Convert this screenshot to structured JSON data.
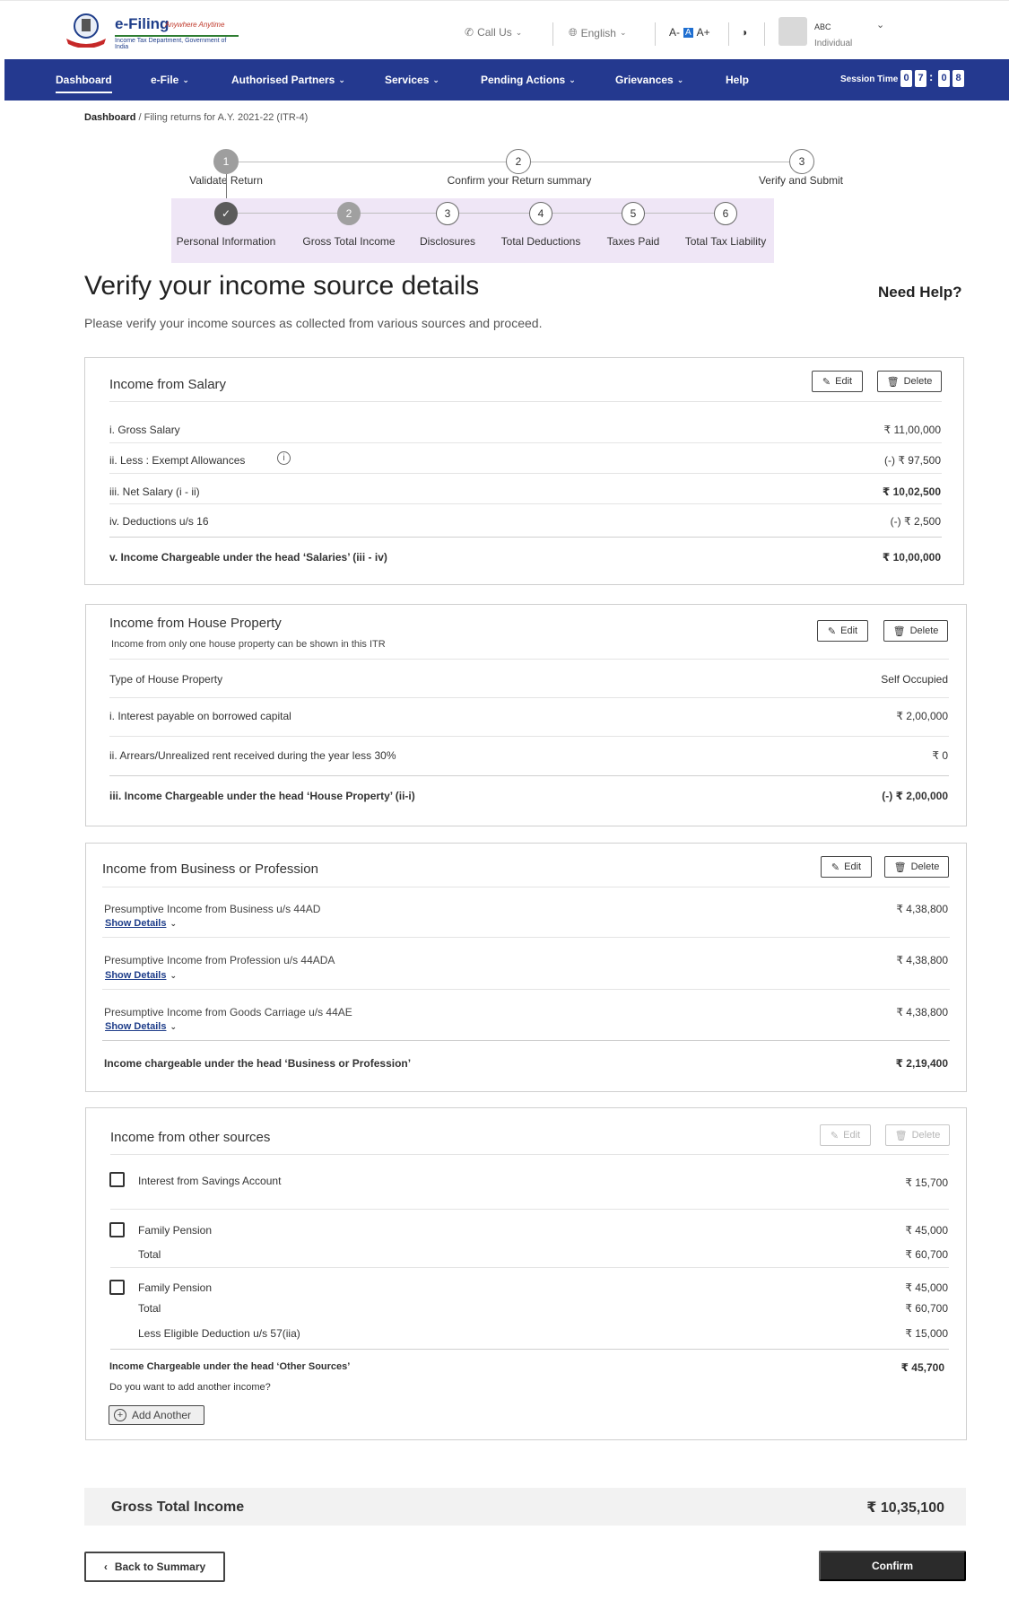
{
  "header": {
    "logo_title": "e-Filing",
    "logo_tagline": "Anywhere Anytime",
    "logo_subtitle": "Income Tax Department, Government of India",
    "call_us": "Call Us",
    "language": "English",
    "font_small": "A-",
    "font_normal": "A",
    "font_large": "A+",
    "user_name": "ABC",
    "user_type": "Individual"
  },
  "nav": {
    "items": [
      "Dashboard",
      "e-File",
      "Authorised Partners",
      "Services",
      "Pending Actions",
      "Grievances",
      "Help"
    ],
    "session_label": "Session Time",
    "session_digits": [
      "0",
      "7",
      "0",
      "8"
    ]
  },
  "breadcrumb": {
    "root": "Dashboard",
    "current": "/ Filing returns for A.Y. 2021-22 (ITR-4)"
  },
  "stepper": {
    "steps": [
      {
        "num": "1",
        "label": "Validate Return"
      },
      {
        "num": "2",
        "label": "Confirm your Return summary"
      },
      {
        "num": "3",
        "label": "Verify and Submit"
      }
    ],
    "substeps": [
      {
        "num": "✓",
        "label": "Personal Information"
      },
      {
        "num": "2",
        "label": "Gross Total Income"
      },
      {
        "num": "3",
        "label": "Disclosures"
      },
      {
        "num": "4",
        "label": "Total Deductions"
      },
      {
        "num": "5",
        "label": "Taxes Paid"
      },
      {
        "num": "6",
        "label": "Total Tax Liability"
      }
    ]
  },
  "page": {
    "title": "Verify your income source details",
    "need_help": "Need Help?",
    "description": "Please verify your income sources as collected from various sources and proceed."
  },
  "buttons": {
    "edit": "Edit",
    "delete": "Delete",
    "show_details": "Show Details",
    "add_another": "Add Another",
    "back": "Back to Summary",
    "confirm": "Confirm"
  },
  "salary": {
    "title": "Income from Salary",
    "rows": [
      {
        "label": "i. Gross Salary",
        "value": "₹ 11,00,000"
      },
      {
        "label": "ii. Less : Exempt Allowances",
        "value": "(-) ₹ 97,500"
      },
      {
        "label": "iii. Net Salary (i - ii)",
        "value": "₹ 10,02,500"
      },
      {
        "label": "iv. Deductions u/s 16",
        "value": "(-) ₹ 2,500"
      },
      {
        "label": "v. Income Chargeable under the head ‘Salaries’  (iii - iv)",
        "value": "₹ 10,00,000"
      }
    ]
  },
  "house": {
    "title": "Income from House Property",
    "note": "Income from only one house property can be shown in this ITR",
    "rows": [
      {
        "label": "Type of House Property",
        "value": "Self Occupied"
      },
      {
        "label": "i. Interest payable on borrowed capital",
        "value": "₹ 2,00,000"
      },
      {
        "label": "ii. Arrears/Unrealized rent received during the year less 30%",
        "value": "₹ 0"
      },
      {
        "label": "iii. Income Chargeable under the head ‘House Property’ (ii-i)",
        "value": "(-) ₹ 2,00,000"
      }
    ]
  },
  "business": {
    "title": "Income from Business or Profession",
    "rows": [
      {
        "label": "Presumptive Income from Business u/s 44AD",
        "value": "₹ 4,38,800"
      },
      {
        "label": "Presumptive Income from Profession u/s 44ADA",
        "value": "₹ 4,38,800"
      },
      {
        "label": "Presumptive Income from Goods Carriage u/s 44AE",
        "value": "₹ 4,38,800"
      },
      {
        "label": "Income chargeable under the head ‘Business or Profession’",
        "value": "₹ 2,19,400"
      }
    ]
  },
  "other": {
    "title": "Income from other sources",
    "interest_label": "Interest from Savings Account",
    "interest_value": "₹ 15,700",
    "pension1_label": "Family Pension",
    "pension1_value": "₹ 45,000",
    "total1_label": "Total",
    "total1_value": "₹ 60,700",
    "pension2_label": "Family Pension",
    "pension2_value": "₹ 45,000",
    "total2_label": "Total",
    "total2_value": "₹ 60,700",
    "less_label": "Less Eligible Deduction u/s 57(iia)",
    "less_value": "₹ 15,000",
    "chargeable_label": "Income Chargeable under the head ‘Other Sources’",
    "chargeable_value": "₹ 45,700",
    "question": "Do you want to add another income?"
  },
  "gross_total": {
    "label": "Gross Total Income",
    "value": "₹ 10,35,100"
  }
}
